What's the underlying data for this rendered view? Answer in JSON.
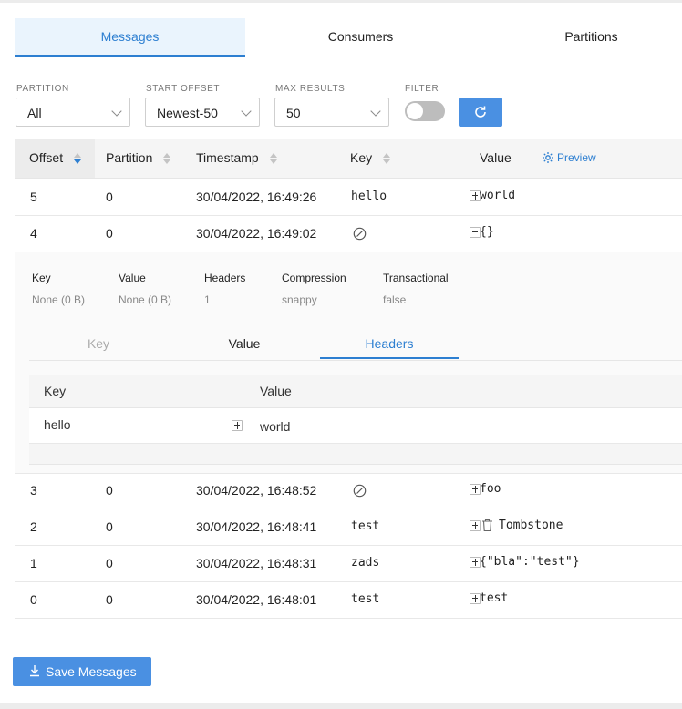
{
  "tabs": [
    {
      "label": "Messages",
      "active": true
    },
    {
      "label": "Consumers",
      "active": false
    },
    {
      "label": "Partitions",
      "active": false
    }
  ],
  "filters": {
    "partition": {
      "label": "PARTITION",
      "value": "All"
    },
    "start_offset": {
      "label": "START OFFSET",
      "value": "Newest-50"
    },
    "max_results": {
      "label": "MAX RESULTS",
      "value": "50"
    },
    "filter": {
      "label": "FILTER",
      "enabled": false
    }
  },
  "table": {
    "columns": {
      "offset": "Offset",
      "partition": "Partition",
      "timestamp": "Timestamp",
      "key": "Key",
      "value": "Value",
      "preview": "Preview"
    },
    "rows": [
      {
        "offset": "5",
        "partition": "0",
        "timestamp": "30/04/2022, 16:49:26",
        "key": "hello",
        "value": "world"
      },
      {
        "offset": "4",
        "partition": "0",
        "timestamp": "30/04/2022, 16:49:02",
        "key": null,
        "value": "{}"
      },
      {
        "offset": "3",
        "partition": "0",
        "timestamp": "30/04/2022, 16:48:52",
        "key": null,
        "value": "foo"
      },
      {
        "offset": "2",
        "partition": "0",
        "timestamp": "30/04/2022, 16:48:41",
        "key": "test",
        "value": "Tombstone"
      },
      {
        "offset": "1",
        "partition": "0",
        "timestamp": "30/04/2022, 16:48:31",
        "key": "zads",
        "value": "{\"bla\":\"test\"}"
      },
      {
        "offset": "0",
        "partition": "0",
        "timestamp": "30/04/2022, 16:48:01",
        "key": "test",
        "value": "test"
      }
    ]
  },
  "expanded": {
    "info": [
      {
        "label": "Key",
        "value": "None (0 B)"
      },
      {
        "label": "Value",
        "value": "None (0 B)"
      },
      {
        "label": "Headers",
        "value": "1"
      },
      {
        "label": "Compression",
        "value": "snappy"
      },
      {
        "label": "Transactional",
        "value": "false"
      }
    ],
    "tabs": [
      {
        "label": "Key",
        "state": "disabled"
      },
      {
        "label": "Value",
        "state": "normal"
      },
      {
        "label": "Headers",
        "state": "active"
      }
    ],
    "headers_table": {
      "col_key": "Key",
      "col_value": "Value",
      "rows": [
        {
          "key": "hello",
          "value": "world"
        }
      ]
    }
  },
  "actions": {
    "save": "Save Messages"
  },
  "colors": {
    "accent": "#2d7fd1",
    "button": "#4a90e2"
  },
  "icons": {
    "refresh": "refresh-icon",
    "preview": "gear-icon",
    "null_key": "null-icon",
    "tombstone": "trash-icon",
    "save": "download-icon"
  }
}
